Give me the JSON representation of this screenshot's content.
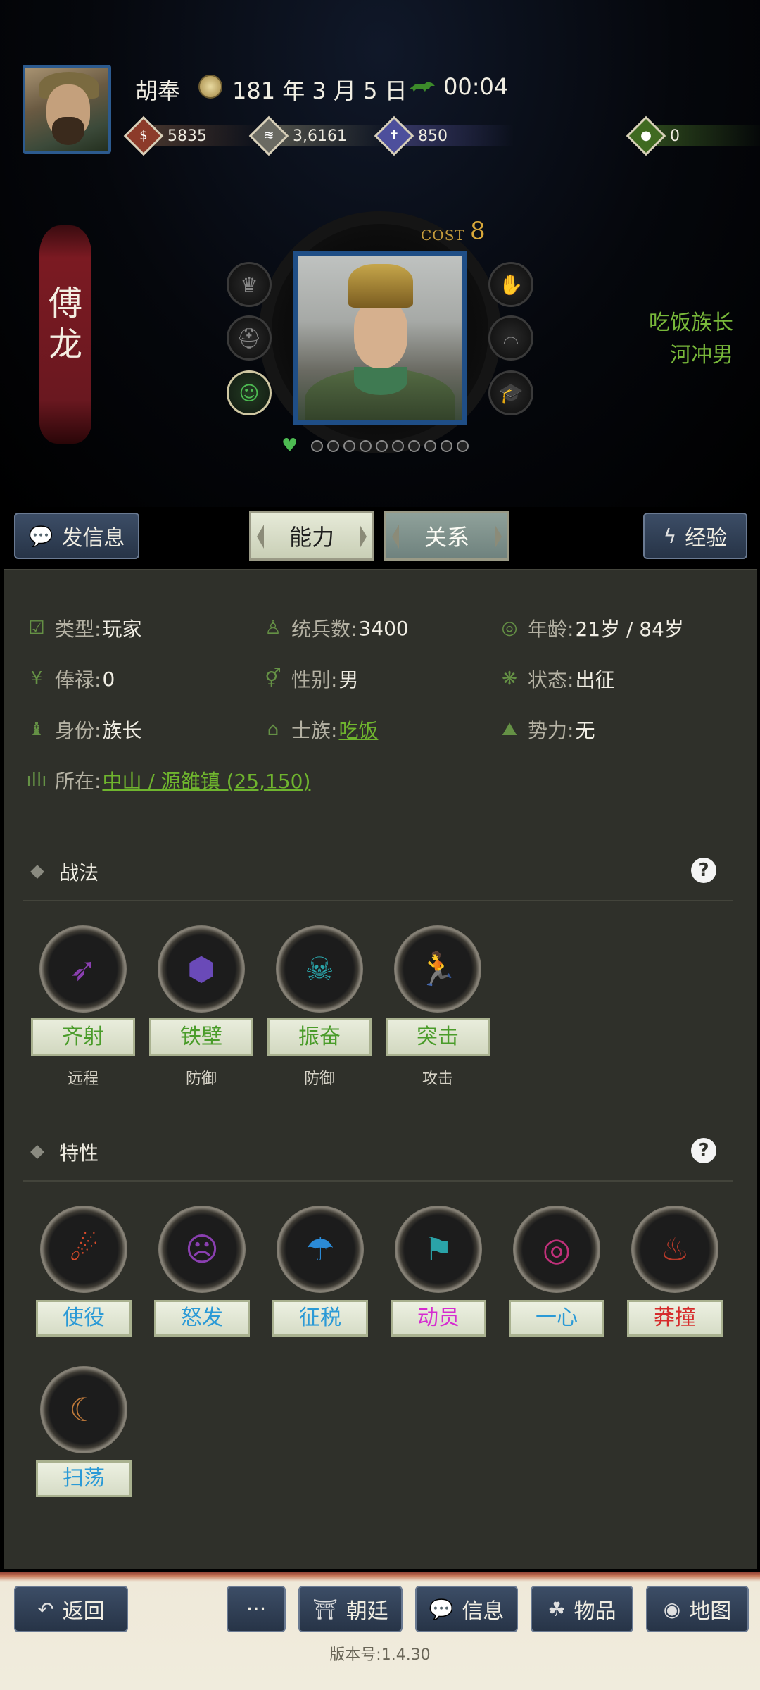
{
  "header": {
    "player_name": "胡奉",
    "date": "181 年 3 月 5 日",
    "time": "00:04",
    "resources": [
      {
        "icon": "coin-icon",
        "value": "5835",
        "color": "#c0523a"
      },
      {
        "icon": "grain-icon",
        "value": "3,6161",
        "color": "#c9c9c0"
      },
      {
        "icon": "soldier-icon",
        "value": "850",
        "color": "#5b5fa8"
      },
      {
        "icon": "gourd-icon",
        "value": "0",
        "color": "#5b8c2a"
      }
    ]
  },
  "character": {
    "name_banner": "傅龙",
    "cost_label": "COST",
    "cost_value": "8",
    "titles": [
      "吃饭族长",
      "河冲男"
    ]
  },
  "actions": {
    "send_message": "发信息",
    "tab_ability": "能力",
    "tab_relation": "关系",
    "experience": "经验"
  },
  "info": {
    "type_k": "类型:",
    "type_v": "玩家",
    "troops_k": "统兵数:",
    "troops_v": "3400",
    "age_k": "年龄:",
    "age_v": "21岁 / 84岁",
    "salary_k": "俸禄:",
    "salary_v": "0",
    "gender_k": "性别:",
    "gender_v": "男",
    "status_k": "状态:",
    "status_v": "出征",
    "identity_k": "身份:",
    "identity_v": "族长",
    "clan_k": "士族:",
    "clan_v": "吃饭",
    "faction_k": "势力:",
    "faction_v": "无",
    "location_k": "所在:",
    "location_v": "中山 / 源雒镇 (25,150)"
  },
  "tactics": {
    "title": "战法",
    "help": "?",
    "items": [
      {
        "label": "齐射",
        "type": "远程",
        "color": "#4a9c2a"
      },
      {
        "label": "铁壁",
        "type": "防御",
        "color": "#4a9c2a"
      },
      {
        "label": "振奋",
        "type": "防御",
        "color": "#4a9c2a"
      },
      {
        "label": "突击",
        "type": "攻击",
        "color": "#4a9c2a"
      }
    ]
  },
  "traits": {
    "title": "特性",
    "help": "?",
    "items": [
      {
        "label": "使役",
        "color": "#2b9ad6"
      },
      {
        "label": "怒发",
        "color": "#2b9ad6"
      },
      {
        "label": "征税",
        "color": "#2b9ad6"
      },
      {
        "label": "动员",
        "color": "#d62bd0"
      },
      {
        "label": "一心",
        "color": "#2b9ad6"
      },
      {
        "label": "莽撞",
        "color": "#d62b2b"
      },
      {
        "label": "扫荡",
        "color": "#2b9ad6"
      }
    ]
  },
  "bottom": {
    "back": "返回",
    "more": "···",
    "court": "朝廷",
    "message": "信息",
    "items": "物品",
    "map": "地图",
    "version": "版本号:1.4.30"
  }
}
